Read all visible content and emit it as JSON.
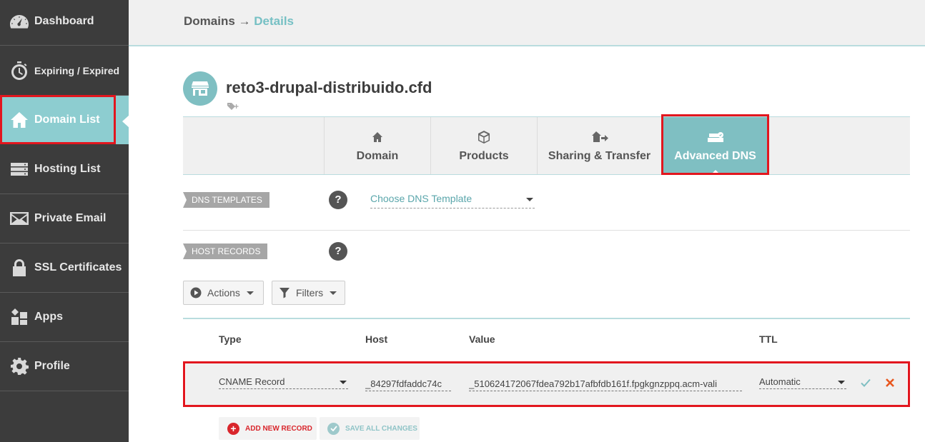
{
  "sidebar": {
    "items": [
      {
        "label": "Dashboard",
        "icon": "speedometer-icon"
      },
      {
        "label": "Expiring / Expired",
        "icon": "stopwatch-icon"
      },
      {
        "label": "Domain List",
        "icon": "home-icon"
      },
      {
        "label": "Hosting List",
        "icon": "server-icon"
      },
      {
        "label": "Private Email",
        "icon": "envelope-icon"
      },
      {
        "label": "SSL Certificates",
        "icon": "lock-icon"
      },
      {
        "label": "Apps",
        "icon": "apps-grid-icon"
      },
      {
        "label": "Profile",
        "icon": "gear-icon"
      }
    ],
    "active_index": 2
  },
  "breadcrumb": {
    "parent": "Domains",
    "separator": "→",
    "current": "Details"
  },
  "domain": {
    "name": "reto3-drupal-distribuido.cfd"
  },
  "tabs": [
    {
      "label": "Domain",
      "icon": "home-icon"
    },
    {
      "label": "Products",
      "icon": "box-icon"
    },
    {
      "label": "Sharing & Transfer",
      "icon": "share-icon"
    },
    {
      "label": "Advanced DNS",
      "icon": "dns-icon",
      "active": true
    }
  ],
  "dns_templates": {
    "label": "DNS TEMPLATES",
    "help": "?",
    "select_value": "Choose DNS Template"
  },
  "host_records": {
    "label": "HOST RECORDS",
    "help": "?"
  },
  "toolbar": {
    "actions_label": "Actions",
    "filters_label": "Filters"
  },
  "table": {
    "headers": {
      "type": "Type",
      "host": "Host",
      "value": "Value",
      "ttl": "TTL"
    },
    "record": {
      "type": "CNAME Record",
      "host": "_84297fdfaddc74c",
      "value": "_510624172067fdea792b17afbfdb161f.fpgkgnzppq.acm-vali",
      "ttl": "Automatic"
    }
  },
  "buttons": {
    "add_new": "ADD NEW RECORD",
    "save_all": "SAVE ALL CHANGES"
  },
  "colors": {
    "accent": "#7fbfc2",
    "sidebar": "#3c3c3c",
    "highlight": "#e2161e",
    "delete": "#e8571e",
    "confirm": "#7fbfc2"
  }
}
